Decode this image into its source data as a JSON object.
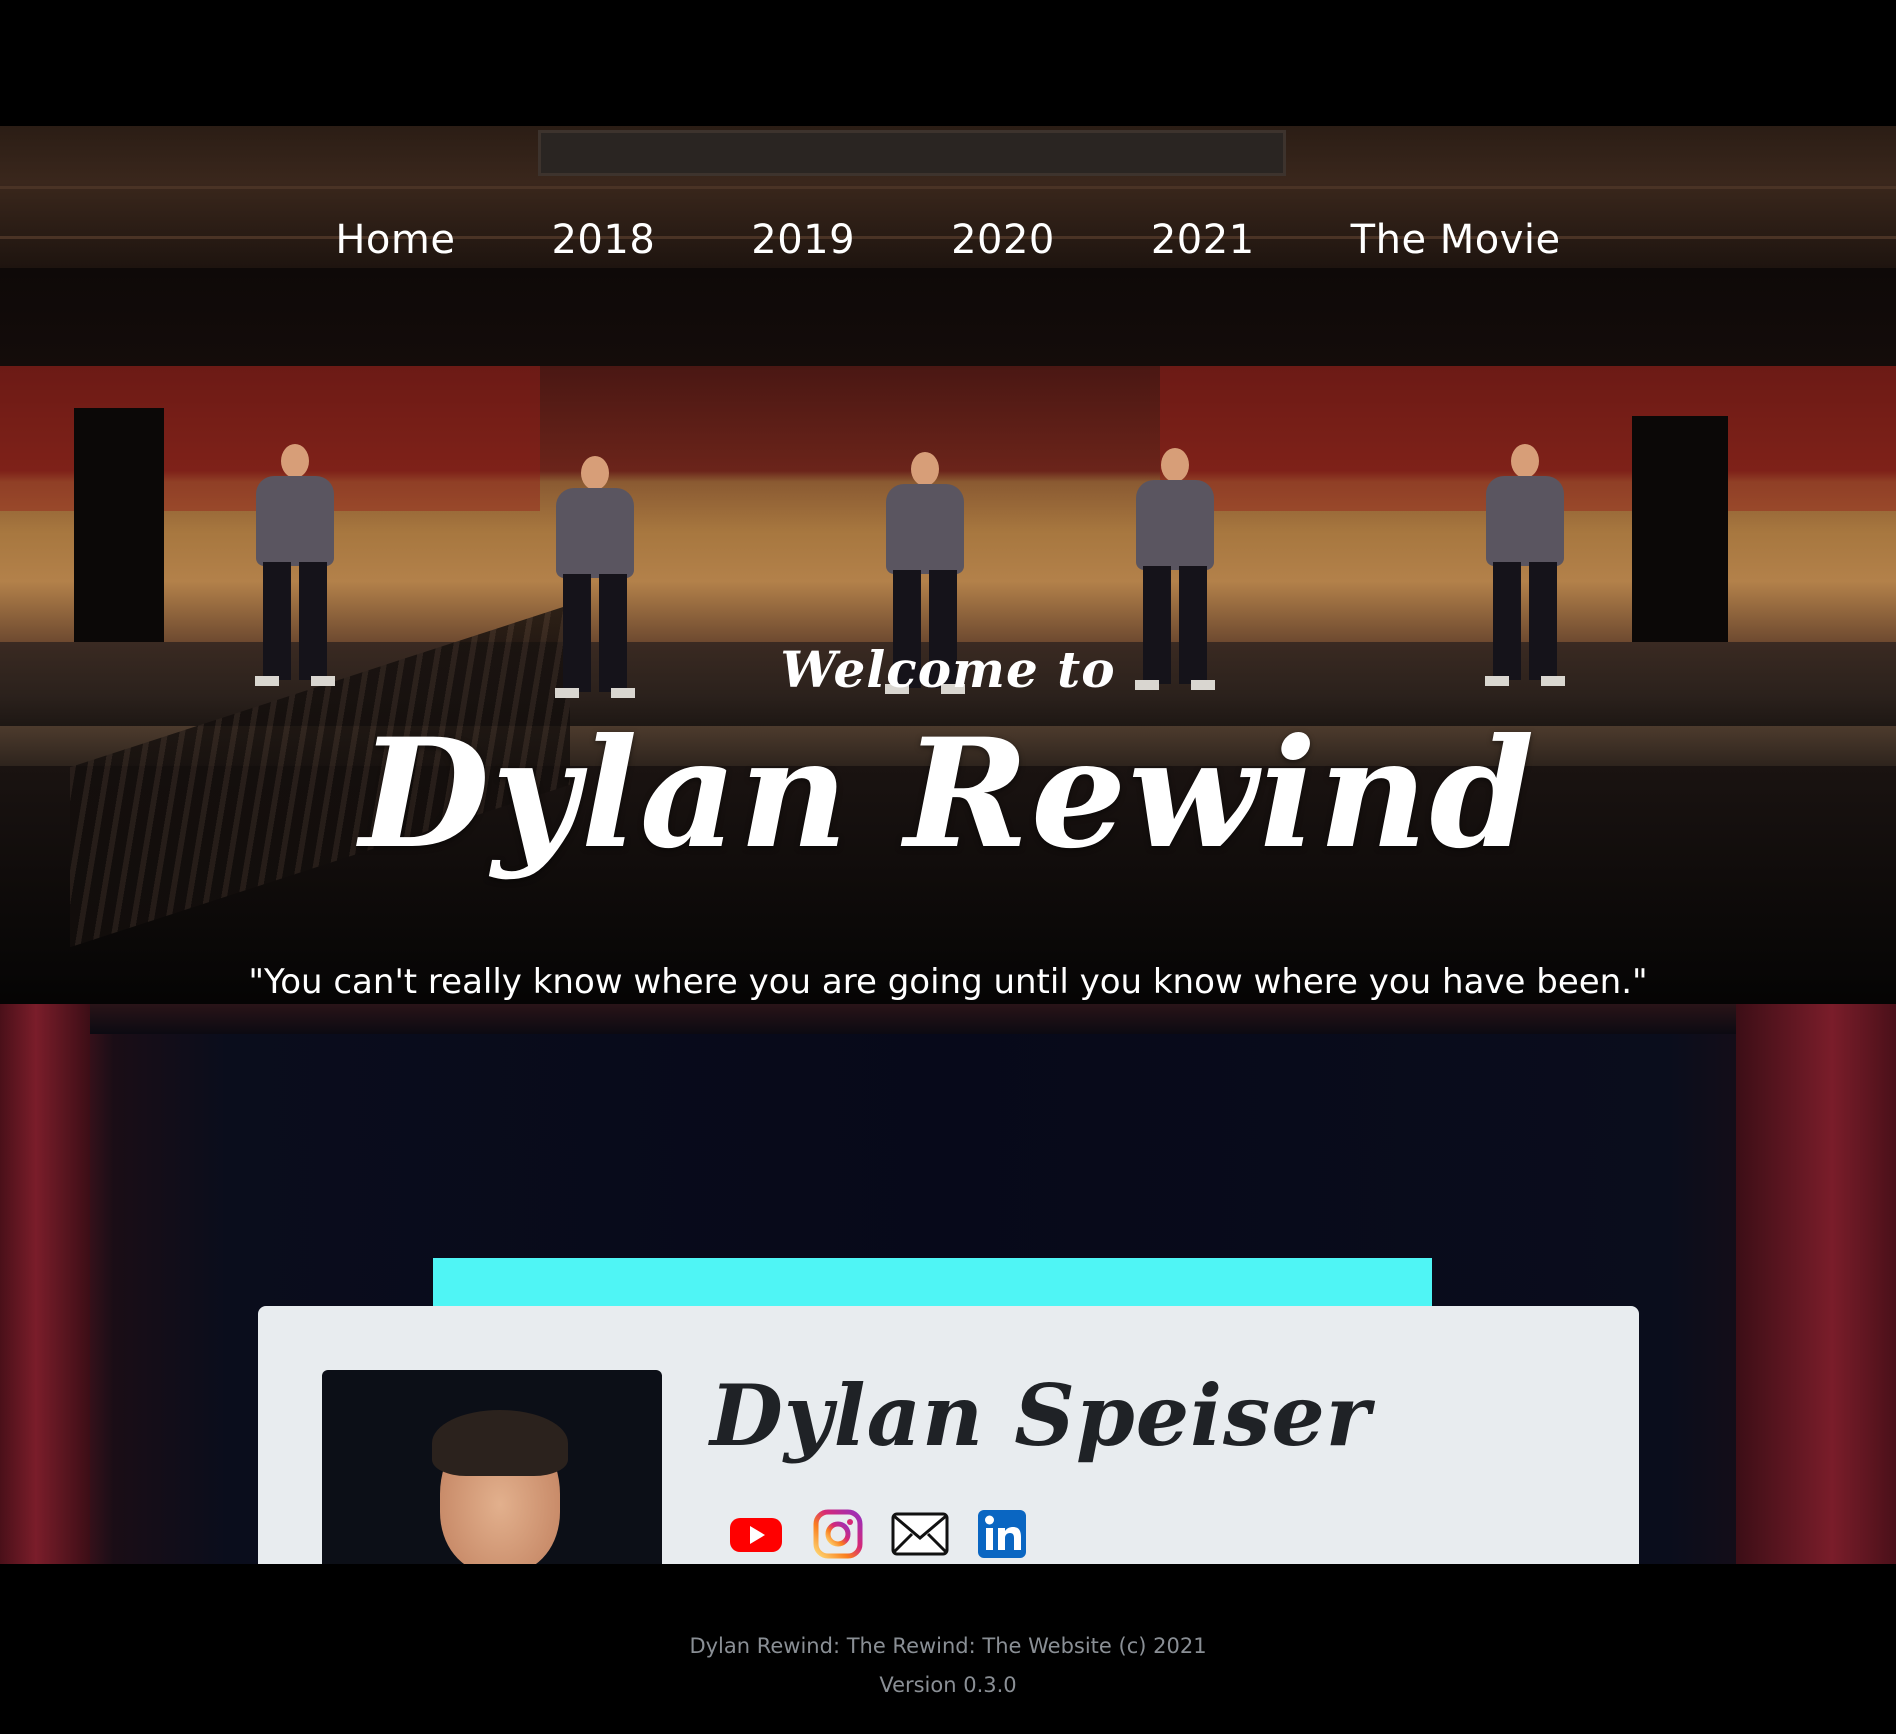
{
  "nav": {
    "items": [
      {
        "label": "Home"
      },
      {
        "label": "2018"
      },
      {
        "label": "2019"
      },
      {
        "label": "2020"
      },
      {
        "label": "2021"
      },
      {
        "label": "The Movie"
      }
    ]
  },
  "hero": {
    "welcome": "Welcome to",
    "title": "Dylan Rewind",
    "tagline": "\"You can't really know where you are going until you know where you have been.\""
  },
  "profile": {
    "name": "Dylan Speiser",
    "social": [
      {
        "name": "youtube-icon",
        "color": "#ff0000"
      },
      {
        "name": "instagram-icon",
        "color": "#d6249f"
      },
      {
        "name": "email-icon",
        "color": "#111111"
      },
      {
        "name": "linkedin-icon",
        "color": "#0a66c2"
      }
    ],
    "accent_screen_color": "#4ff5f5"
  },
  "footer": {
    "line1": "Dylan Rewind: The Rewind: The Website (c) 2021",
    "line2": "Version 0.3.0"
  }
}
